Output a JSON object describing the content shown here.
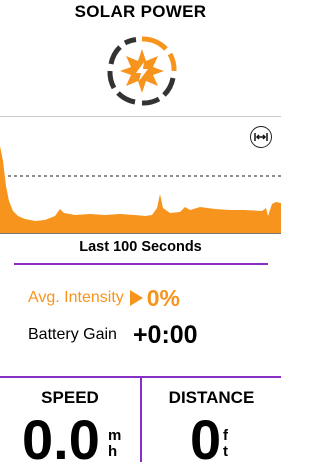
{
  "header": {
    "title": "SOLAR POWER"
  },
  "icons": {
    "solar": "sun-lightning-icon",
    "expand": "expand-horizontal-icon"
  },
  "graph": {
    "caption": "Last 100 Seconds",
    "fill_color": "#f7941d",
    "reference_line": "dashed"
  },
  "stats": {
    "avg_intensity_label": "Avg. Intensity",
    "avg_intensity_value": "0%",
    "battery_gain_label": "Battery Gain",
    "battery_gain_value": "+0:00"
  },
  "fields": {
    "speed": {
      "label": "SPEED",
      "value": "0.0",
      "unit_top": "m",
      "unit_bottom": "h"
    },
    "distance": {
      "label": "DISTANCE",
      "value": "0",
      "unit_top": "f",
      "unit_bottom": "t"
    }
  },
  "colors": {
    "accent": "#f7941d",
    "divider": "#8a2fc4"
  }
}
